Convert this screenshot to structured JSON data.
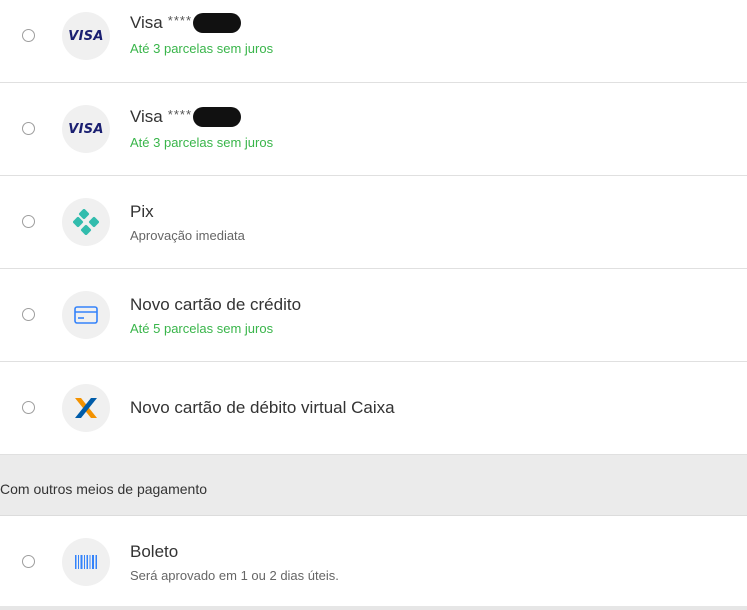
{
  "payment_options": [
    {
      "title": "Visa",
      "masked": "****",
      "subtitle": "Até 3 parcelas sem juros",
      "subtitle_color": "#39b54a",
      "icon": "visa-logo-icon"
    },
    {
      "title": "Visa",
      "masked": "****",
      "subtitle": "Até 3 parcelas sem juros",
      "subtitle_color": "#39b54a",
      "icon": "visa-logo-icon"
    },
    {
      "title": "Pix",
      "subtitle": "Aprovação imediata",
      "subtitle_color": "#666666",
      "icon": "pix-icon"
    },
    {
      "title": "Novo cartão de crédito",
      "subtitle": "Até 5 parcelas sem juros",
      "subtitle_color": "#39b54a",
      "icon": "credit-card-icon"
    },
    {
      "title": "Novo cartão de débito virtual Caixa",
      "icon": "caixa-logo-icon"
    }
  ],
  "visa_logo_text": "VISA",
  "other_section": {
    "header": "Com outros meios de pagamento",
    "options": [
      {
        "title": "Boleto",
        "subtitle": "Será aprovado em 1 ou 2 dias úteis.",
        "subtitle_color": "#666666",
        "icon": "barcode-icon"
      }
    ]
  },
  "colors": {
    "success_green": "#39b54a",
    "visa_blue": "#1a1f71",
    "pix_teal": "#32bcad",
    "card_blue": "#3483fa",
    "caixa_orange": "#f39200",
    "caixa_blue": "#005ca9",
    "section_bg": "#ebebeb"
  }
}
